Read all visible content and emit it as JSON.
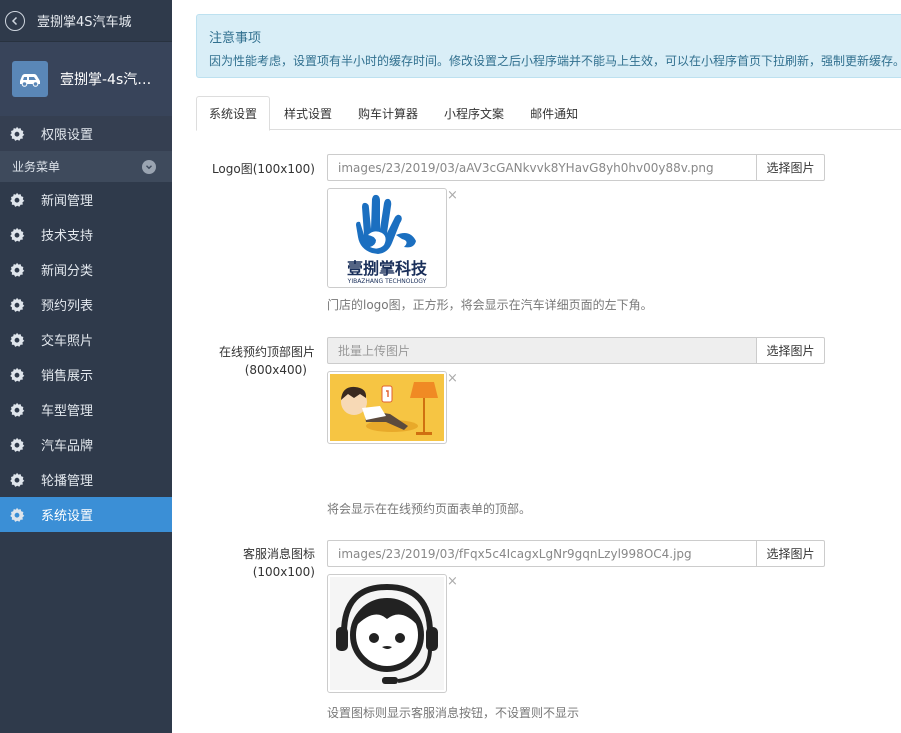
{
  "sidebar": {
    "title": "壹捌掌4S汽车城",
    "store_name": "壹捌掌-4s汽车...",
    "permission_label": "权限设置",
    "group_label": "业务菜单",
    "items": [
      {
        "label": "新闻管理"
      },
      {
        "label": "技术支持"
      },
      {
        "label": "新闻分类"
      },
      {
        "label": "预约列表"
      },
      {
        "label": "交车照片"
      },
      {
        "label": "销售展示"
      },
      {
        "label": "车型管理"
      },
      {
        "label": "汽车品牌"
      },
      {
        "label": "轮播管理"
      },
      {
        "label": "系统设置",
        "active": true
      }
    ]
  },
  "notice": {
    "title": "注意事项",
    "text": "因为性能考虑，设置项有半小时的缓存时间。修改设置之后小程序端并不能马上生效，可以在小程序首页下拉刷新，强制更新缓存。"
  },
  "tabs": [
    {
      "label": "系统设置",
      "active": true
    },
    {
      "label": "样式设置"
    },
    {
      "label": "购车计算器"
    },
    {
      "label": "小程序文案"
    },
    {
      "label": "邮件通知"
    }
  ],
  "form": {
    "pick_label": "选择图片",
    "close_glyph": "×",
    "logo": {
      "label": "Logo图(100x100)",
      "value": "images/23/2019/03/aAV3cGANkvvk8YHavG8yh0hv00y88v.png",
      "logo_main": "壹捌掌科技",
      "logo_sub": "YIBAZHANG TECHNOLOGY",
      "help": "门店的logo图，正方形，将会显示在汽车详细页面的左下角。"
    },
    "booking": {
      "label_line1": "在线预约顶部图片",
      "label_line2": "(800x400)",
      "placeholder": "批量上传图片",
      "help": "将会显示在在线预约页面表单的顶部。"
    },
    "service": {
      "label_line1": "客服消息图标",
      "label_line2": "(100x100)",
      "value": "images/23/2019/03/fFqx5c4IcagxLgNr9gqnLzyl998OC4.jpg",
      "help": "设置图标则显示客服消息按钮，不设置则不显示"
    }
  },
  "colors": {
    "sidebar_bg": "#2f3a4b",
    "active_blue": "#3b8fd6",
    "notice_bg": "#d9eef7",
    "notice_text": "#31708f"
  }
}
